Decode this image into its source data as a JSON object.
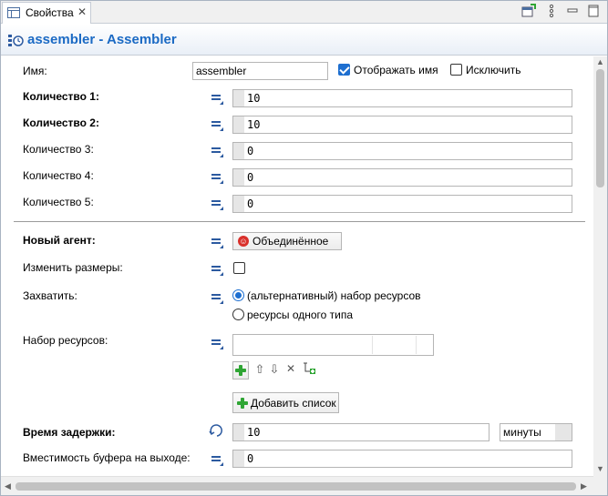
{
  "tab": {
    "label": "Свойства",
    "close": "✕"
  },
  "toolbar_icons": [
    "pin-view-icon",
    "view-menu-icon",
    "minimize-icon",
    "maximize-icon"
  ],
  "header": {
    "title": "assembler - Assembler",
    "icon": "assembler-block-icon",
    "title_color": "#1b6ac4"
  },
  "name_row": {
    "label": "Имя:",
    "value": "assembler",
    "show_name": {
      "label": "Отображать имя",
      "checked": true
    },
    "exclude": {
      "label": "Исключить",
      "checked": false
    }
  },
  "quantities": [
    {
      "label": "Количество 1:",
      "value": "10",
      "bold": true
    },
    {
      "label": "Количество 2:",
      "value": "10",
      "bold": true
    },
    {
      "label": "Количество 3:",
      "value": "0",
      "bold": false
    },
    {
      "label": "Количество 4:",
      "value": "0",
      "bold": false
    },
    {
      "label": "Количество 5:",
      "value": "0",
      "bold": false
    }
  ],
  "new_agent": {
    "label": "Новый агент:",
    "value": "Объединённое",
    "icon": "agent-person-icon"
  },
  "resize": {
    "label": "Изменить размеры:",
    "checked": false
  },
  "seize": {
    "label": "Захватить:",
    "options": [
      {
        "label": "(альтернативный) набор ресурсов",
        "selected": true
      },
      {
        "label": "ресурсы одного типа",
        "selected": false
      }
    ]
  },
  "resource_sets": {
    "label": "Набор ресурсов:",
    "tools": [
      "add-icon",
      "move-up-icon",
      "move-down-icon",
      "delete-icon",
      "add-set-icon"
    ],
    "add_list_label": "Добавить список"
  },
  "delay_time": {
    "label": "Время задержки:",
    "value": "10",
    "units": "минуты"
  },
  "output_buffer": {
    "label": "Вместимость буфера на выходе:",
    "value": "0"
  },
  "colors": {
    "accent": "#1e6fd0",
    "plus_green": "#2fa534",
    "agent_red": "#d9302b"
  }
}
